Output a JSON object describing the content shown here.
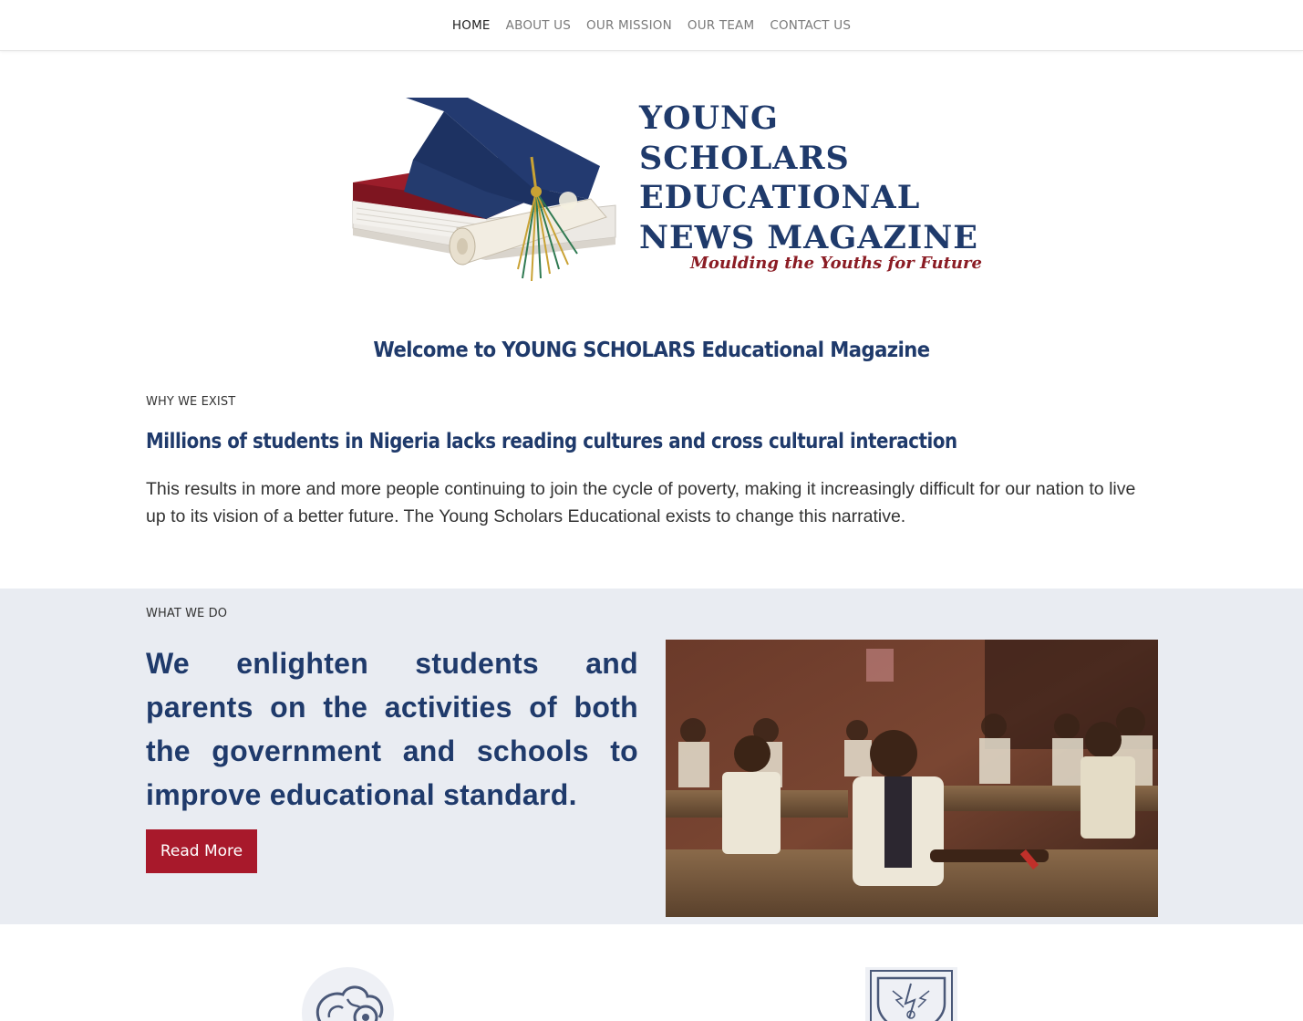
{
  "nav": {
    "items": [
      {
        "label": "HOME",
        "active": true
      },
      {
        "label": "ABOUT US",
        "active": false
      },
      {
        "label": "OUR MISSION",
        "active": false
      },
      {
        "label": "OUR TEAM",
        "active": false
      },
      {
        "label": "CONTACT US",
        "active": false
      }
    ]
  },
  "logo": {
    "lines": [
      "YOUNG",
      "SCHOLARS",
      "EDUCATIONAL",
      "NEWS MAGAZINE"
    ],
    "tagline": "Moulding the Youths for Future",
    "colors": {
      "navy": "#1f3a6b",
      "red": "#8b1c24"
    }
  },
  "welcome": {
    "title": "Welcome to YOUNG SCHOLARS Educational Magazine"
  },
  "why": {
    "eyebrow": "WHY WE EXIST",
    "heading": "Millions of students in Nigeria lacks reading cultures and cross cultural interaction",
    "body": "This results in more and more people continuing to join the cycle of poverty, making it increasingly difficult for our nation to live up to its vision of a better future. The Young Scholars Educational exists to change this narrative."
  },
  "what": {
    "eyebrow": "WHAT WE DO",
    "title": "We enlighten students and parents on the activities of both the government and schools to improve educational standard.",
    "button": "Read More",
    "colors": {
      "section_bg": "#e9ecf2",
      "button_bg": "#a8192b"
    }
  },
  "bottom_icons": [
    {
      "icon": "brain-gear-icon"
    },
    {
      "icon": "shield-badge-icon"
    }
  ]
}
